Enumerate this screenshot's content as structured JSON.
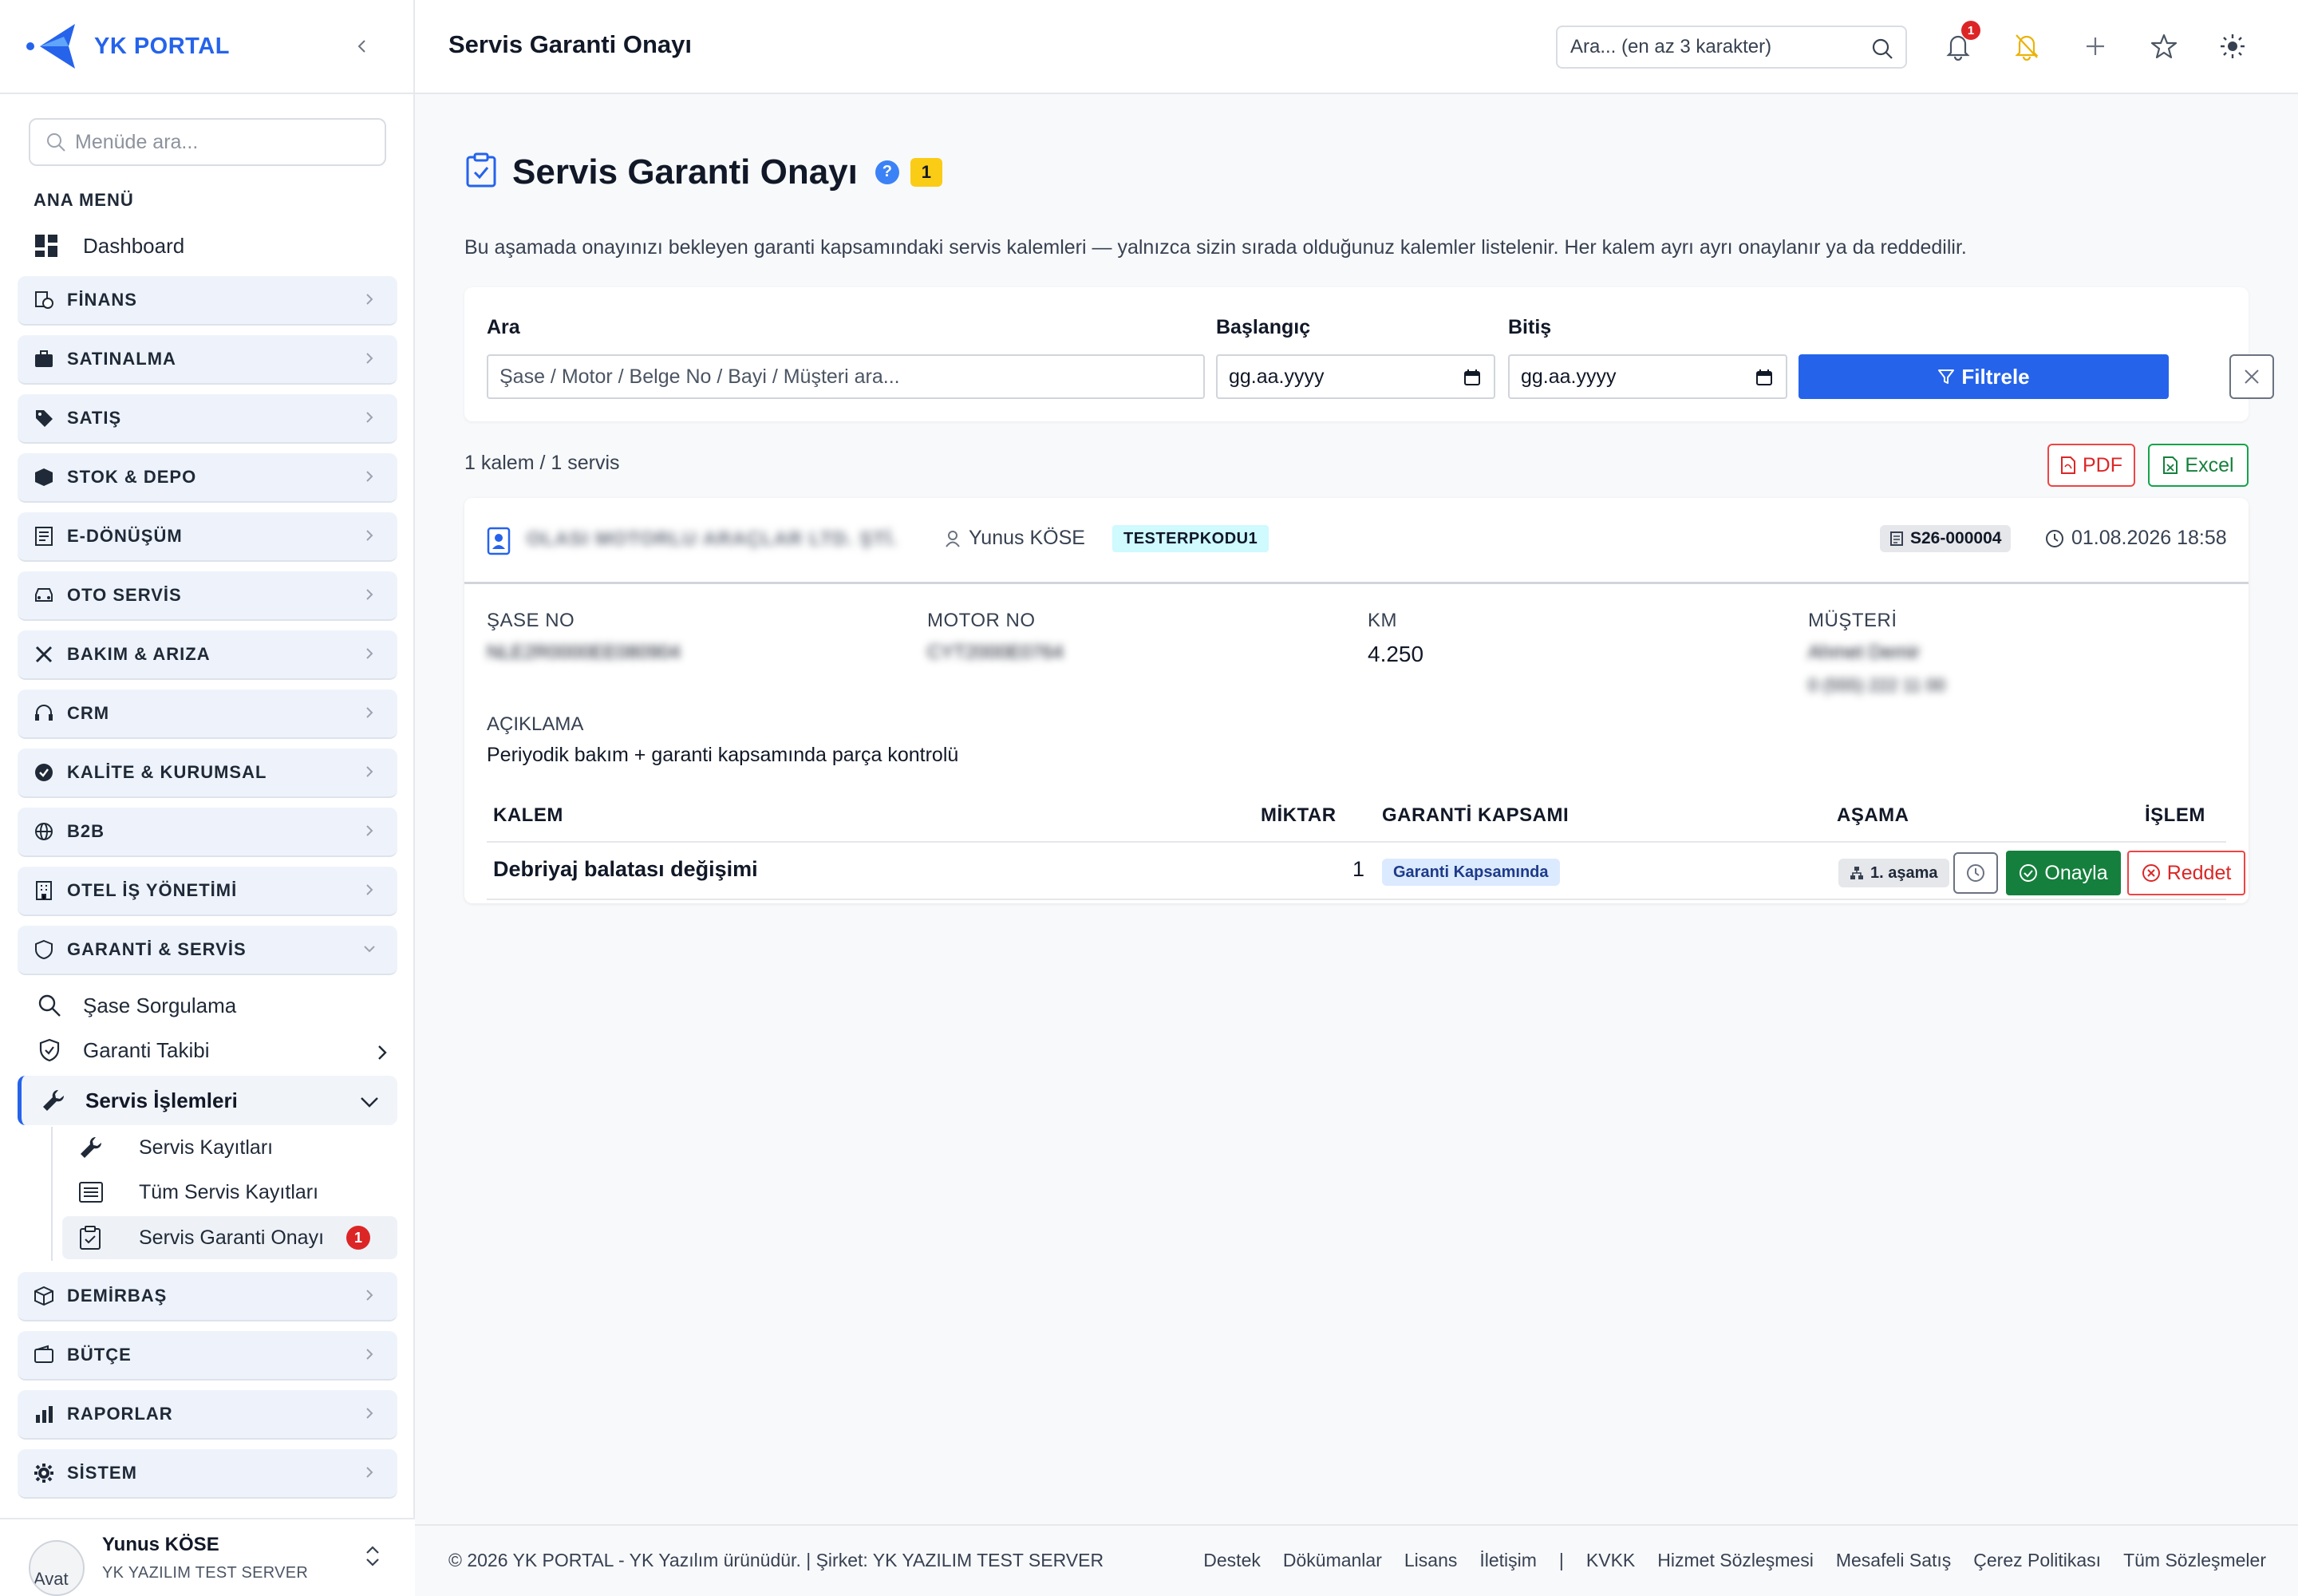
{
  "brand": {
    "name": "YK PORTAL"
  },
  "sidebar": {
    "search_placeholder": "Menüde ara...",
    "section_title": "ANA MENÜ",
    "dashboard": "Dashboard",
    "groups": [
      {
        "label": "FİNANS",
        "icon": "finance-icon"
      },
      {
        "label": "SATINALMA",
        "icon": "briefcase-icon"
      },
      {
        "label": "SATIŞ",
        "icon": "tag-icon"
      },
      {
        "label": "STOK & DEPO",
        "icon": "box-icon"
      },
      {
        "label": "E-DÖNÜŞÜM",
        "icon": "document-icon"
      },
      {
        "label": "OTO SERVİS",
        "icon": "car-icon"
      },
      {
        "label": "BAKIM & ARIZA",
        "icon": "tools-icon"
      },
      {
        "label": "CRM",
        "icon": "headset-icon"
      },
      {
        "label": "KALİTE & KURUMSAL",
        "icon": "quality-icon"
      },
      {
        "label": "B2B",
        "icon": "globe-icon"
      },
      {
        "label": "OTEL İŞ YÖNETİMİ",
        "icon": "hotel-icon"
      },
      {
        "label": "GARANTİ & SERVİS",
        "icon": "shield-icon"
      }
    ],
    "garanti_sub": {
      "sase": "Şase Sorgulama",
      "takip": "Garanti Takibi",
      "servis": "Servis İşlemleri",
      "servis_kayit": "Servis Kayıtları",
      "tum_kayit": "Tüm Servis Kayıtları",
      "onay": "Servis Garanti Onayı",
      "onay_badge": "1"
    },
    "groups_after": [
      {
        "label": "DEMİRBAŞ",
        "icon": "cube-icon"
      },
      {
        "label": "BÜTÇE",
        "icon": "wallet-icon"
      },
      {
        "label": "RAPORLAR",
        "icon": "bar-chart-icon"
      },
      {
        "label": "SİSTEM",
        "icon": "gear-icon"
      }
    ],
    "user": {
      "name": "Yunus KÖSE",
      "company": "YK YAZILIM TEST SERVER",
      "avatar_alt": "Avat"
    }
  },
  "topbar": {
    "title": "Servis Garanti Onayı",
    "search_placeholder": "Ara... (en az 3 karakter)",
    "notif_count": "1"
  },
  "page": {
    "title": "Servis Garanti Onayı",
    "help": "?",
    "count": "1",
    "description": "Bu aşamada onayınızı bekleyen garanti kapsamındaki servis kalemleri — yalnızca sizin sırada olduğunuz kalemler listelenir. Her kalem ayrı ayrı onaylanır ya da reddedilir."
  },
  "filter": {
    "search_label": "Ara",
    "search_placeholder": "Şase / Motor / Belge No / Bayi / Müşteri ara...",
    "start_label": "Başlangıç",
    "start_value": "gg.aa.yyyy",
    "end_label": "Bitiş",
    "end_value": "gg.aa.yyyy",
    "filter_button": "Filtrele"
  },
  "summary": "1 kalem / 1 servis",
  "export": {
    "pdf": "PDF",
    "excel": "Excel"
  },
  "record": {
    "company": "OLASI MOTORLU ARAÇLAR LTD. ŞTİ.",
    "user": "Yunus KÖSE",
    "dealer_code": "TESTERPKODU1",
    "doc_no": "S26-000004",
    "date": "01.08.2026 18:58",
    "fields": {
      "sase_label": "ŞASE NO",
      "sase_value": "NLE2R0000EE080904",
      "motor_label": "MOTOR NO",
      "motor_value": "CYT2000E0764",
      "km_label": "KM",
      "km_value": "4.250",
      "musteri_label": "MÜŞTERİ",
      "musteri_value": "Ahmet Demir",
      "musteri_phone": "0 (555) 222 11 00"
    },
    "aciklama_label": "AÇIKLAMA",
    "aciklama": "Periyodik bakım + garanti kapsamında parça kontrolü",
    "table_headers": {
      "kalem": "KALEM",
      "miktar": "MİKTAR",
      "garanti": "GARANTİ KAPSAMI",
      "asama": "AŞAMA",
      "islem": "İŞLEM"
    },
    "items": [
      {
        "name": "Debriyaj balatası değişimi",
        "qty": "1",
        "coverage": "Garanti Kapsamında",
        "stage": "1. aşama"
      }
    ],
    "approve": "Onayla",
    "reject": "Reddet"
  },
  "footer": {
    "copyright": "© 2026 YK PORTAL - YK Yazılım ürünüdür. | Şirket: YK YAZILIM TEST SERVER",
    "links": [
      "Destek",
      "Dökümanlar",
      "Lisans",
      "İletişim",
      "|",
      "KVKK",
      "Hizmet Sözleşmesi",
      "Mesafeli Satış",
      "Çerez Politikası",
      "Tüm Sözleşmeler"
    ]
  },
  "colors": {
    "accent": "#2563eb",
    "success": "#15803d",
    "danger": "#dc2626",
    "warning": "#facc15"
  }
}
